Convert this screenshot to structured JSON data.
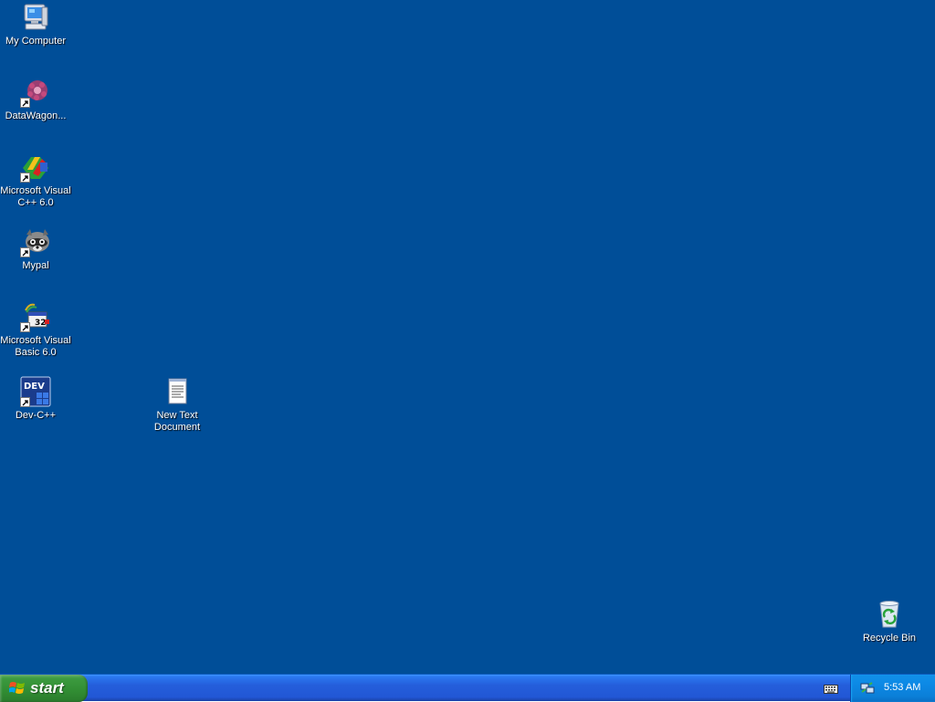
{
  "desktop": {
    "background_color": "#004e98",
    "icons": [
      {
        "label": "My Computer",
        "icon": "my-computer-icon"
      },
      {
        "label": "DataWagon...",
        "icon": "datawagon-icon",
        "shortcut": true
      },
      {
        "label": "Microsoft Visual\nC++ 6.0",
        "icon": "visual-cpp-icon",
        "shortcut": true
      },
      {
        "label": "Mypal",
        "icon": "mypal-icon",
        "shortcut": true
      },
      {
        "label": "Microsoft Visual\nBasic 6.0",
        "icon": "visual-basic-icon",
        "shortcut": true
      },
      {
        "label": "Dev-C++",
        "icon": "dev-cpp-icon",
        "shortcut": true
      },
      {
        "label": "New Text\nDocument",
        "icon": "text-document-icon"
      },
      {
        "label": "Recycle Bin",
        "icon": "recycle-bin-icon"
      }
    ]
  },
  "taskbar": {
    "start_label": "start",
    "start_icon": "windows-logo-icon",
    "language_icon": "keyboard-icon",
    "tray": {
      "network_icon": "network-icon",
      "clock": "5:53 AM"
    }
  }
}
